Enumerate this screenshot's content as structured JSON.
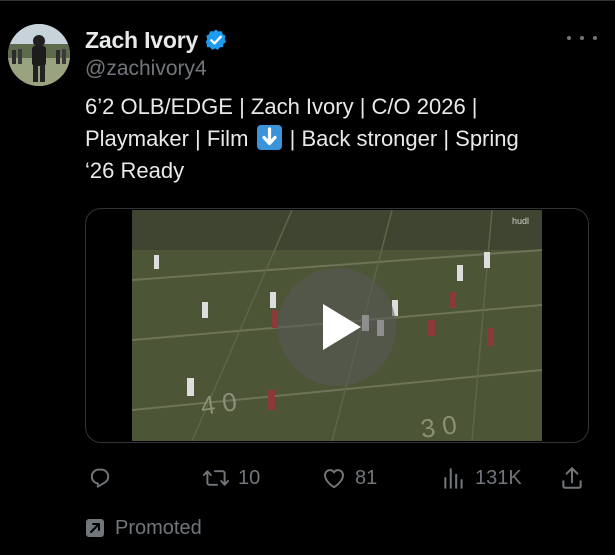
{
  "author": {
    "display_name": "Zach Ivory",
    "handle": "@zachivory4",
    "verified": true,
    "verified_color": "#1d9bf0"
  },
  "tweet": {
    "line1": "6’2 OLB/EDGE | Zach Ivory | C/O 2026 |",
    "line2_prefix": "Playmaker | Film",
    "line2_suffix": "| Back stronger | Spring",
    "line3": "‘26 Ready",
    "emoji": "down-arrow-emoji"
  },
  "media": {
    "type": "video",
    "play_icon": "play-icon",
    "watermark": "hudl"
  },
  "actions": {
    "reply": {
      "icon": "reply-icon",
      "count": ""
    },
    "retweet": {
      "icon": "retweet-icon",
      "count": "10"
    },
    "like": {
      "icon": "heart-icon",
      "count": "81"
    },
    "views": {
      "icon": "views-icon",
      "count": "131K"
    },
    "share": {
      "icon": "share-icon",
      "count": ""
    }
  },
  "promoted": {
    "label": "Promoted",
    "icon": "promoted-icon"
  },
  "colors": {
    "background": "#000000",
    "text": "#e7e9ea",
    "muted": "#71767b",
    "border": "#2f3336",
    "accent": "#1d9bf0"
  }
}
